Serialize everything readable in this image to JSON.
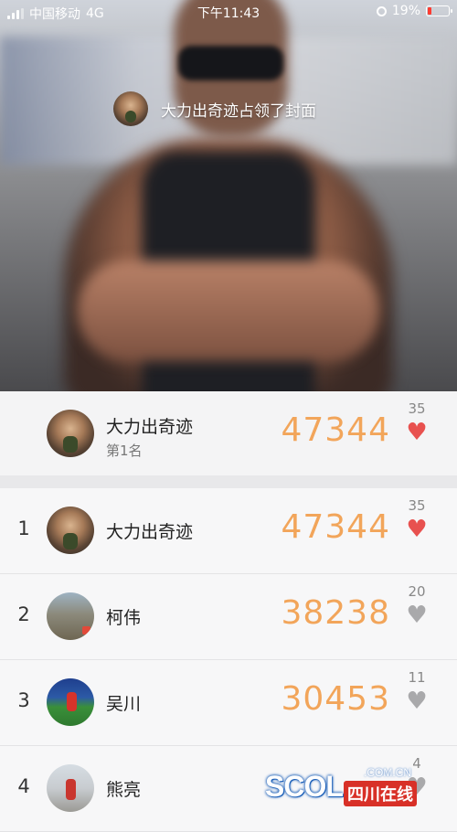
{
  "status_bar": {
    "carrier": "中国移动",
    "network": "4G",
    "time": "下午11:43",
    "battery_percent": "19%",
    "battery_level": 0.19
  },
  "cover": {
    "caption": "大力出奇迹占领了封面"
  },
  "featured": {
    "name": "大力出奇迹",
    "subtitle": "第1名",
    "score": "47344",
    "likes": "35",
    "liked": true
  },
  "leaderboard": [
    {
      "rank": "1",
      "name": "大力出奇迹",
      "score": "47344",
      "likes": "35",
      "liked": true,
      "avatar": "muscle-avatar"
    },
    {
      "rank": "2",
      "name": "柯伟",
      "score": "38238",
      "likes": "20",
      "liked": false,
      "avatar": "city-avatar"
    },
    {
      "rank": "3",
      "name": "吴川",
      "score": "30453",
      "likes": "11",
      "liked": false,
      "avatar": "soccer-avatar"
    },
    {
      "rank": "4",
      "name": "熊亮",
      "score": "",
      "likes": "4",
      "liked": false,
      "avatar": "kid-avatar"
    }
  ],
  "watermark": {
    "logo": "SCOL",
    "domain": ".COM.CN",
    "tagline": "四川在线"
  },
  "colors": {
    "score": "#f2a55a",
    "heart_on": "#e8514f",
    "heart_off": "#a9a9ab"
  }
}
